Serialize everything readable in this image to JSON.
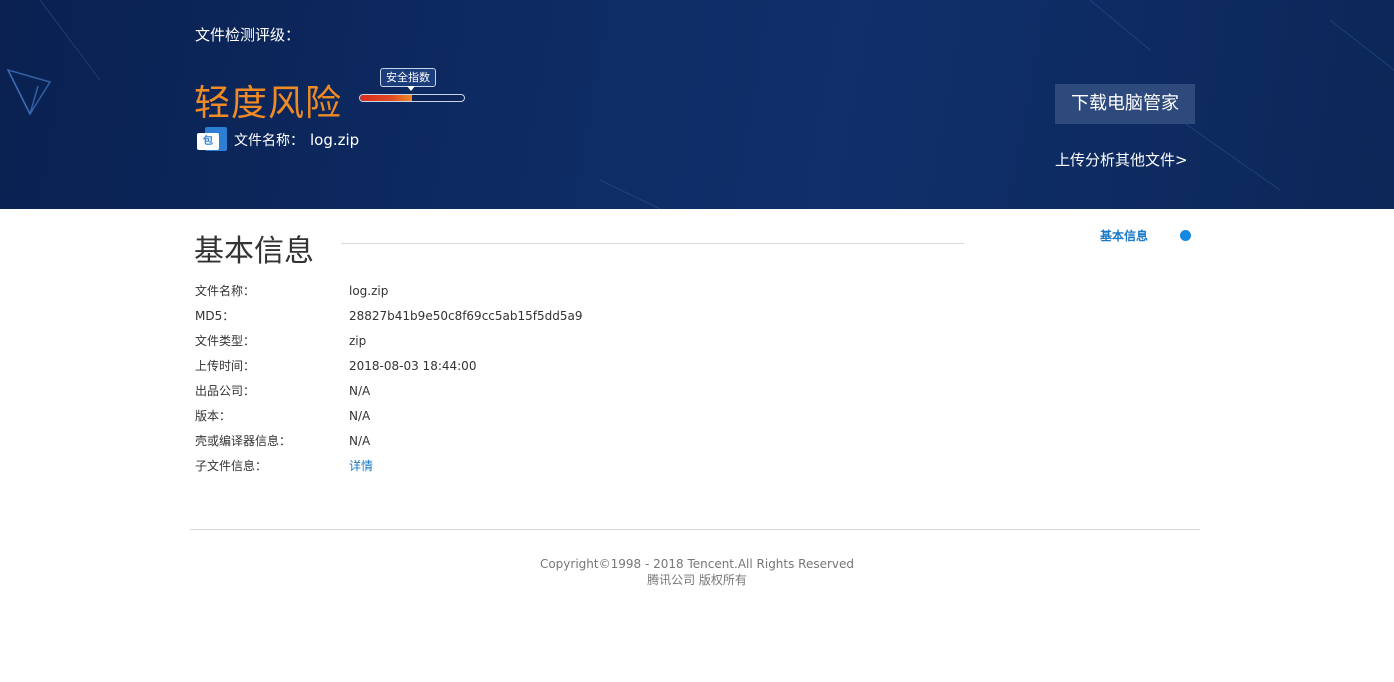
{
  "banner": {
    "rating_label": "文件检测评级：",
    "risk_level": "轻度风险",
    "risk_color": "#f08a24",
    "safety_index_label": "安全指数",
    "safety_index_level": 0.5,
    "file_icon_text": "包",
    "file_name_label": "文件名称：",
    "file_name_value": "log.zip",
    "download_button": "下载电脑管家",
    "upload_link": "上传分析其他文件>"
  },
  "section": {
    "title": "基本信息",
    "nav_label": "基本信息",
    "rows": [
      {
        "key": "文件名称：",
        "value": "log.zip"
      },
      {
        "key": "MD5：",
        "value": "28827b41b9e50c8f69cc5ab15f5dd5a9"
      },
      {
        "key": "文件类型：",
        "value": "zip"
      },
      {
        "key": "上传时间：",
        "value": "2018-08-03 18:44:00"
      },
      {
        "key": "出品公司：",
        "value": "N/A"
      },
      {
        "key": "版本：",
        "value": "N/A"
      },
      {
        "key": "壳或编译器信息：",
        "value": "N/A"
      },
      {
        "key": "子文件信息：",
        "value": "详情"
      }
    ]
  },
  "footer": {
    "copyright": "Copyright©1998 - 2018 Tencent.All Rights Reserved",
    "company": "腾讯公司 版权所有"
  },
  "colors": {
    "banner_bg": "#0d2a62",
    "accent_blue": "#1a7ac8",
    "button_bg": "#2e4a7c"
  }
}
